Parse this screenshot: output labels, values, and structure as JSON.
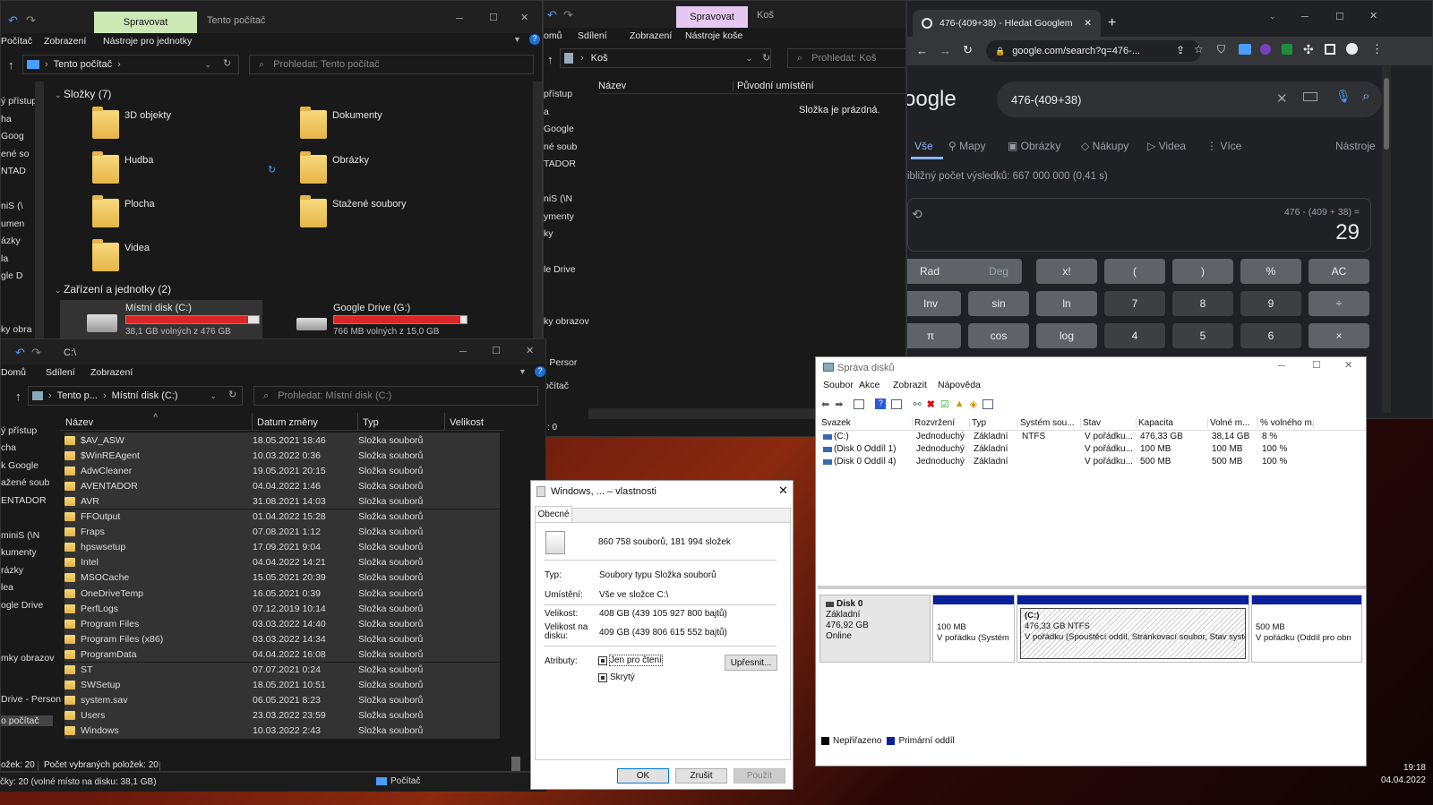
{
  "explorer_top": {
    "tab_manage": "Spravovat",
    "title": "Tento počítač",
    "menu": [
      "Počítač",
      "Zobrazení",
      "Nástroje pro jednotky"
    ],
    "breadcrumb": "Tento počítač",
    "search_placeholder": "Prohledat: Tento počítač",
    "folders_header": "Složky (7)",
    "folders": [
      "3D objekty",
      "Dokumenty",
      "Hudba",
      "Obrázky",
      "Plocha",
      "Stažené soubory",
      "Videa"
    ],
    "devices_header": "Zařízení a jednotky (2)",
    "drives": [
      {
        "name": "Místní disk (C:)",
        "free": "38,1 GB volných z 476 GB",
        "fill": 0.92
      },
      {
        "name": "Google Drive (G:)",
        "free": "766 MB volných z 15,0 GB",
        "fill": 0.95
      }
    ],
    "nav": [
      "ý přístup",
      "ha",
      "Goog",
      "ené so",
      "NTAD",
      "niS (\\",
      "umen",
      "ázky",
      "la",
      "gle D",
      "ky obra"
    ]
  },
  "recycle": {
    "tab_manage": "Spravovat",
    "title": "Koš",
    "menu": [
      "omů",
      "Sdílení",
      "Zobrazení",
      "Nástroje koše"
    ],
    "breadcrumb": "Koš",
    "search_placeholder": "Prohledat: Koš",
    "col_name": "Název",
    "col_orig": "Původní umístění",
    "empty": "Složka je prázdná.",
    "nav": [
      "přístup",
      "a",
      "Google",
      "né soub",
      "TADOR",
      "niS (\\N",
      "ymenty",
      "ky",
      "",
      "le Drive",
      "ky obrazov",
      "- Persor",
      "očítač"
    ],
    "status": ": 0"
  },
  "explorer_c": {
    "title": "C:\\",
    "menu": [
      "Domů",
      "Sdílení",
      "Zobrazení"
    ],
    "breadcrumb": [
      "Tento p...",
      "Místní disk (C:)"
    ],
    "search_placeholder": "Prohledat: Místní disk (C:)",
    "cols": [
      "Název",
      "Datum změny",
      "Typ",
      "Velikost"
    ],
    "rows": [
      [
        "$AV_ASW",
        "18.05.2021 18:46",
        "Složka souborů"
      ],
      [
        "$WinREAgent",
        "10.03.2022 0:36",
        "Složka souborů"
      ],
      [
        "AdwCleaner",
        "19.05.2021 20:15",
        "Složka souborů"
      ],
      [
        "AVENTADOR",
        "04.04.2022 1:46",
        "Složka souborů"
      ],
      [
        "AVR",
        "31.08.2021 14:03",
        "Složka souborů"
      ],
      [
        "FFOutput",
        "01.04.2022 15:28",
        "Složka souborů"
      ],
      [
        "Fraps",
        "07.08.2021 1:12",
        "Složka souborů"
      ],
      [
        "hpswsetup",
        "17.09.2021 9:04",
        "Složka souborů"
      ],
      [
        "Intel",
        "04.04.2022 14:21",
        "Složka souborů"
      ],
      [
        "MSOCache",
        "15.05.2021 20:39",
        "Složka souborů"
      ],
      [
        "OneDriveTemp",
        "16.05.2021 0:39",
        "Složka souborů"
      ],
      [
        "PerfLogs",
        "07.12.2019 10:14",
        "Složka souborů"
      ],
      [
        "Program Files",
        "03.03.2022 14:40",
        "Složka souborů"
      ],
      [
        "Program Files (x86)",
        "03.03.2022 14:34",
        "Složka souborů"
      ],
      [
        "ProgramData",
        "04.04.2022 16:08",
        "Složka souborů"
      ],
      [
        "ST",
        "07.07.2021 0:24",
        "Složka souborů"
      ],
      [
        "SWSetup",
        "18.05.2021 10:51",
        "Složka souborů"
      ],
      [
        "system.sav",
        "06.05.2021 8:23",
        "Složka souborů"
      ],
      [
        "Users",
        "23.03.2022 23:59",
        "Složka souborů"
      ],
      [
        "Windows",
        "10.03.2022 2:43",
        "Složka souborů"
      ]
    ],
    "nav": [
      "ý přístup",
      "cha",
      "k Google",
      "ažené soub",
      "ENTADOR",
      "",
      "miniS (\\N",
      "kumenty",
      "rázky",
      "lea",
      "ogle Drive",
      "",
      "mky obrazov",
      "",
      "Drive - Person",
      "o počítač"
    ],
    "status_left": "ožek: 20",
    "status_sel": "Počet vybraných položek: 20"
  },
  "taskbar": {
    "status": "čky: 20 (volné místo na disku: 38,1 GB)",
    "computer": "Počítač",
    "time": "19:18",
    "date": "04.04.2022"
  },
  "props": {
    "title": "Windows, ... – vlastnosti",
    "tab": "Obecné",
    "summary": "860 758 souborů, 181 994 složek",
    "labels": [
      "Typ:",
      "Umístění:",
      "Velikost:",
      "Velikost na disku:",
      "Atributy:"
    ],
    "values": [
      "Soubory typu Složka souborů",
      "Vše ve složce C:\\",
      "408 GB (439 105 927 800 bajtů)",
      "409 GB (439 806 615 552 bajtů)"
    ],
    "readonly": "Jen pro čtení",
    "hidden": "Skrytý",
    "advanced": "Upřesnit...",
    "ok": "OK",
    "cancel": "Zrušit",
    "apply": "Použít"
  },
  "chrome": {
    "tab_title": "476-(409+38) - Hledat Googlem",
    "url": "google.com/search?q=476-...",
    "logo": "oogle",
    "query": "476-(409+38)",
    "tabs": [
      "Vše",
      "Mapy",
      "Obrázky",
      "Nákupy",
      "Videa",
      "Více",
      "Nástroje"
    ],
    "results": "ibližný počet výsledků: 667 000 000 (0,41 s)",
    "expr": "476 - (409 + 38) =",
    "result": "29",
    "buttons": [
      [
        "Rad",
        "op"
      ],
      [
        "Deg",
        "op"
      ],
      [
        "x!",
        "op"
      ],
      [
        "(",
        "op"
      ],
      [
        ")",
        "op"
      ],
      [
        "%",
        "op"
      ],
      [
        "AC",
        "op"
      ],
      [
        "Inv",
        "op"
      ],
      [
        "sin",
        "op"
      ],
      [
        "ln",
        "op"
      ],
      [
        "7",
        "num"
      ],
      [
        "8",
        "num"
      ],
      [
        "9",
        "num"
      ],
      [
        "÷",
        "op"
      ],
      [
        "π",
        "op"
      ],
      [
        "cos",
        "op"
      ],
      [
        "log",
        "op"
      ],
      [
        "4",
        "num"
      ],
      [
        "5",
        "num"
      ],
      [
        "6",
        "num"
      ],
      [
        "×",
        "op"
      ]
    ]
  },
  "diskmgmt": {
    "title": "Správa disků",
    "menu": [
      "Soubor",
      "Akce",
      "Zobrazit",
      "Nápověda"
    ],
    "cols": [
      "Svazek",
      "Rozvržení",
      "Typ",
      "Systém sou...",
      "Stav",
      "Kapacita",
      "Volné m...",
      "% volného m..."
    ],
    "rows": [
      [
        "(C:)",
        "Jednoduchý",
        "Základní",
        "NTFS",
        "V pořádku...",
        "476,33 GB",
        "38,14 GB",
        "8 %"
      ],
      [
        "(Disk 0 Oddíl 1)",
        "Jednoduchý",
        "Základní",
        "",
        "V pořádku...",
        "100 MB",
        "100 MB",
        "100 %"
      ],
      [
        "(Disk 0 Oddíl 4)",
        "Jednoduchý",
        "Základní",
        "",
        "V pořádku...",
        "500 MB",
        "500 MB",
        "100 %"
      ]
    ],
    "disk": {
      "name": "Disk 0",
      "type": "Základní",
      "size": "476,92 GB",
      "state": "Online"
    },
    "parts": [
      {
        "size": "100 MB",
        "state": "V pořádku (Systém"
      },
      {
        "name": "(C:)",
        "size": "476,33 GB NTFS",
        "state": "V pořádku (Spouštěcí oddíl, Stránkovací soubor, Stav systé"
      },
      {
        "size": "500 MB",
        "state": "V pořádku (Oddíl pro obn"
      }
    ],
    "legend": [
      "Nepřiřazeno",
      "Primární oddíl"
    ],
    "colors": {
      "primary": "#0a1f9a",
      "unalloc": "#000000"
    }
  }
}
